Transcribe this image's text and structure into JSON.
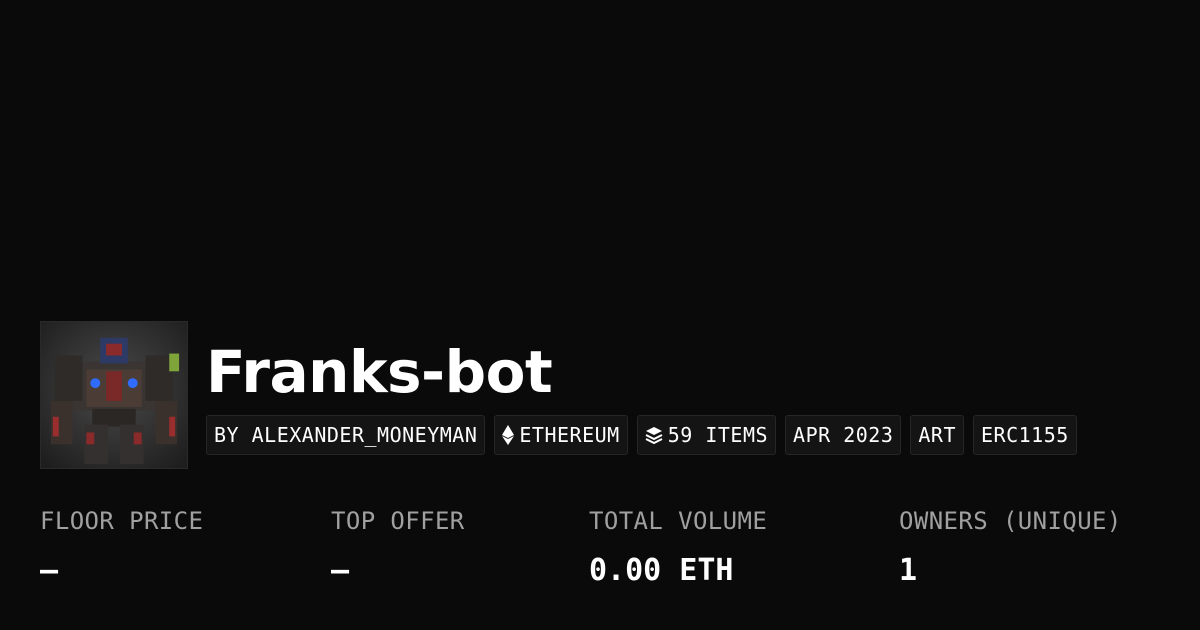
{
  "collection": {
    "name": "Franks-bot",
    "avatar_icon": "robot-avatar-image"
  },
  "tags": [
    {
      "label": "BY ALEXANDER_MONEYMAN"
    },
    {
      "label": "ETHEREUM",
      "icon": "ethereum-icon"
    },
    {
      "label": "59 ITEMS",
      "icon": "layers-icon"
    },
    {
      "label": "APR 2023"
    },
    {
      "label": "ART"
    },
    {
      "label": "ERC1155"
    }
  ],
  "stats": [
    {
      "label": "FLOOR PRICE",
      "value": "–"
    },
    {
      "label": "TOP OFFER",
      "value": "–"
    },
    {
      "label": "TOTAL VOLUME",
      "value": "0.00 ETH"
    },
    {
      "label": "OWNERS (UNIQUE)",
      "value": "1"
    }
  ],
  "colors": {
    "background": "#0a0a0a",
    "tag_background": "#141414",
    "label_gray": "#a0a0a0",
    "text": "#ffffff"
  }
}
